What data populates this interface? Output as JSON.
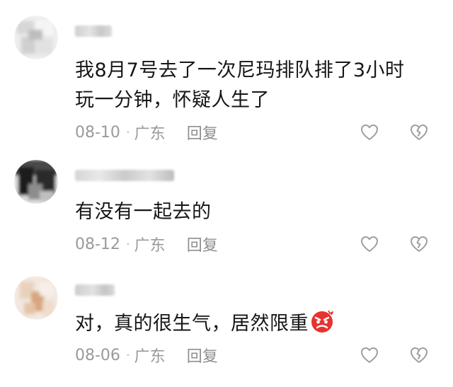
{
  "comments": [
    {
      "text_line1": "我8月7号去了一次尼玛排队排了3小时",
      "text_line2": "玩一分钟，怀疑人生了",
      "date": "08-10",
      "dot": "·",
      "location": "广东",
      "reply_label": "回复",
      "like_icon": "heart-outline-icon",
      "dislike_icon": "broken-heart-outline-icon"
    },
    {
      "text_line1": "有没有一起去的",
      "date": "08-12",
      "dot": "·",
      "location": "广东",
      "reply_label": "回复",
      "like_icon": "heart-outline-icon",
      "dislike_icon": "broken-heart-outline-icon"
    },
    {
      "text_line1": "对，真的很生气，居然限重",
      "emoji": "angry-face-emoji",
      "date": "08-06",
      "dot": "·",
      "location": "广东",
      "reply_label": "回复",
      "like_icon": "heart-outline-icon",
      "dislike_icon": "broken-heart-outline-icon"
    }
  ],
  "colors": {
    "text": "#161616",
    "meta": "#9a9a9a",
    "icon": "#9e9e9e",
    "emoji_red": "#e8322f"
  }
}
